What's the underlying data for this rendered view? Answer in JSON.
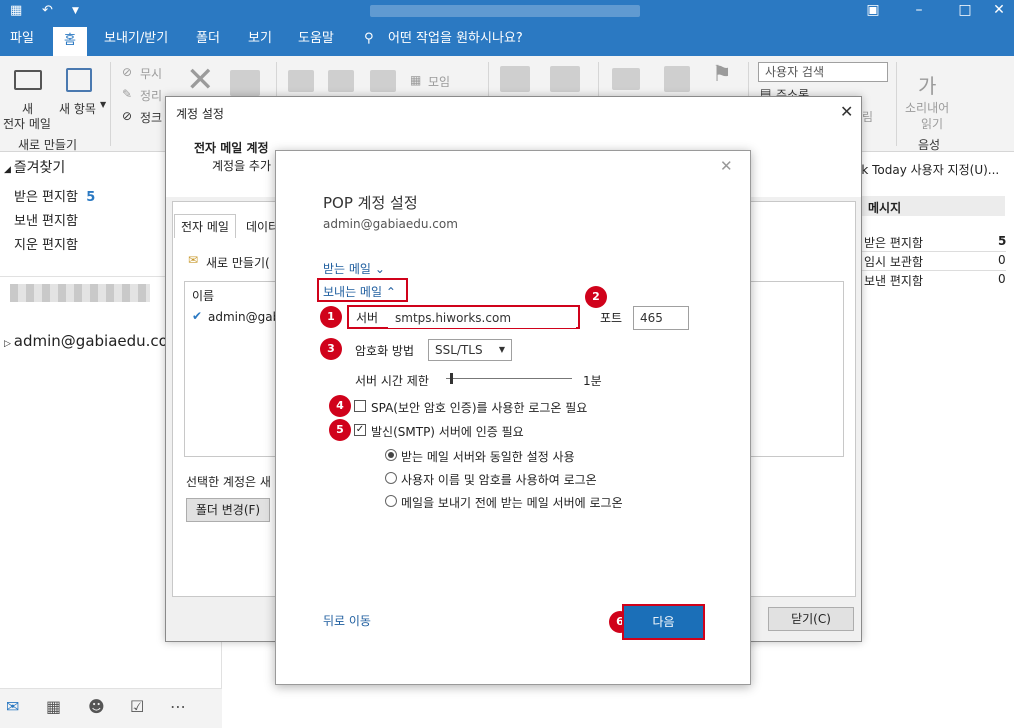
{
  "ribbon_tabs": {
    "file": "파일",
    "home": "홈",
    "send_receive": "보내기/받기",
    "folder": "폴더",
    "view": "보기",
    "help": "도움말",
    "tell_me": "어떤 작업을 원하시나요?"
  },
  "ribbon": {
    "new_email_line1": "새",
    "new_email_line2": "전자 메일",
    "new_items_line1": "새 항목",
    "group_new": "새로 만들기",
    "ignore": "무시",
    "cleanup": "정리",
    "junk": "정크",
    "meeting": "모임",
    "search_people_placeholder": "사용자 검색",
    "address_book": "주소록",
    "read_aloud_line1": "소리내어",
    "read_aloud_line2": "읽기",
    "group_speech": "음성",
    "rules_suffix": "림"
  },
  "nav": {
    "favorites": "즐겨찾기",
    "inbox": "받은 편지함",
    "inbox_count": "5",
    "sent": "보낸 편지함",
    "deleted": "지운 편지함",
    "account": "admin@gabiaedu.com"
  },
  "right_pane": {
    "today_link": "ok Today 사용자 지정(U)...",
    "messages_header": "메시지",
    "rows": [
      {
        "label": "받은 편지함",
        "count": "5"
      },
      {
        "label": "임시 보관함",
        "count": "0"
      },
      {
        "label": "보낸 편지함",
        "count": "0"
      }
    ]
  },
  "account_dialog": {
    "title": "계정 설정",
    "header_title": "전자 메일 계정",
    "header_desc": "계정을 추가",
    "tab_email": "전자 메일",
    "tab_data": "데이터",
    "new_button": "새로 만들기(",
    "col_name": "이름",
    "account_row": "admin@gab",
    "selected_account": "선택한 계정은 새",
    "change_folder": "폴더 변경(F)",
    "close_button": "닫기(C)"
  },
  "pop_dialog": {
    "title": "POP 계정 설정",
    "email": "admin@gabiaedu.com",
    "incoming_mail": "받는 메일",
    "outgoing_mail": "보내는 메일",
    "server_label": "서버",
    "server_value": "smtps.hiworks.com",
    "port_label": "포트",
    "port_value": "465",
    "encryption_label": "암호화 방법",
    "encryption_value": "SSL/TLS",
    "timeout_label": "서버 시간 제한",
    "timeout_value": "1분",
    "spa_label": "SPA(보안 암호 인증)를 사용한 로그온 필요",
    "spa_checked": false,
    "smtp_auth_label": "발신(SMTP) 서버에 인증 필요",
    "smtp_auth_checked": true,
    "radio_same": "받는 메일 서버와 동일한 설정 사용",
    "radio_login": "사용자 이름 및 암호를 사용하여 로그온",
    "radio_before": "메일을 보내기 전에 받는 메일 서버에 로그온",
    "back_link": "뒤로 이동",
    "next_button": "다음"
  },
  "badges": [
    "1",
    "2",
    "3",
    "4",
    "5",
    "6"
  ],
  "colors": {
    "accent": "#2b79c2",
    "annotation_red": "#d0021b",
    "next_button": "#1b6fb8"
  }
}
